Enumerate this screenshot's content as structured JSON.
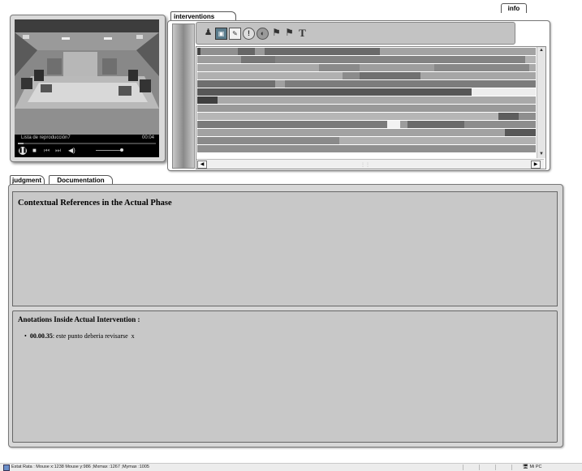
{
  "info_tab": {
    "label": "info"
  },
  "player": {
    "playlist": "Lista de reproducción7",
    "time": "00:04",
    "progress": 0.04,
    "volume": 0.9,
    "icons": [
      "pause-icon",
      "stop-icon",
      "previous-icon",
      "next-icon",
      "volume-icon"
    ]
  },
  "interventions": {
    "tab_label": "interventions",
    "toolbar_icons": [
      "user-search-icon",
      "image-icon",
      "note-icon",
      "alert-icon",
      "globe-icon",
      "flag-icon",
      "flag-icon",
      "text-icon"
    ],
    "scroll": {
      "up": "▲",
      "down": "▼",
      "left": "◀",
      "right": "▶"
    },
    "tracks": [
      {
        "segments": [
          {
            "start": 0.0,
            "end": 0.01,
            "color": "#444444"
          },
          {
            "start": 0.01,
            "end": 0.12,
            "color": "#8f8f8f"
          },
          {
            "start": 0.12,
            "end": 0.17,
            "color": "#666666"
          },
          {
            "start": 0.17,
            "end": 0.2,
            "color": "#9a9a9a"
          },
          {
            "start": 0.2,
            "end": 0.54,
            "color": "#6a6a6a"
          },
          {
            "start": 0.54,
            "end": 1.0,
            "color": "#a3a3a3"
          }
        ]
      },
      {
        "segments": [
          {
            "start": 0.0,
            "end": 0.13,
            "color": "#9d9d9d"
          },
          {
            "start": 0.13,
            "end": 0.23,
            "color": "#767676"
          },
          {
            "start": 0.23,
            "end": 0.97,
            "color": "#838383"
          },
          {
            "start": 0.97,
            "end": 1.0,
            "color": "#b4b4b4"
          }
        ]
      },
      {
        "segments": [
          {
            "start": 0.0,
            "end": 0.36,
            "color": "#a9a9a9"
          },
          {
            "start": 0.36,
            "end": 0.48,
            "color": "#8a8a8a"
          },
          {
            "start": 0.48,
            "end": 0.7,
            "color": "#9e9e9e"
          },
          {
            "start": 0.7,
            "end": 0.98,
            "color": "#888888"
          },
          {
            "start": 0.98,
            "end": 1.0,
            "color": "#aaaaaa"
          }
        ]
      },
      {
        "segments": [
          {
            "start": 0.0,
            "end": 0.43,
            "color": "#b0b0b0"
          },
          {
            "start": 0.43,
            "end": 0.48,
            "color": "#8b8b8b"
          },
          {
            "start": 0.48,
            "end": 0.66,
            "color": "#707070"
          },
          {
            "start": 0.66,
            "end": 1.0,
            "color": "#a6a6a6"
          }
        ]
      },
      {
        "segments": [
          {
            "start": 0.0,
            "end": 0.23,
            "color": "#6f6f6f"
          },
          {
            "start": 0.23,
            "end": 0.26,
            "color": "#a0a0a0"
          },
          {
            "start": 0.26,
            "end": 1.0,
            "color": "#7c7c7c"
          }
        ]
      },
      {
        "segments": [
          {
            "start": 0.0,
            "end": 0.81,
            "color": "#575757"
          },
          {
            "start": 0.81,
            "end": 1.0,
            "color": "#ededed"
          }
        ]
      },
      {
        "segments": [
          {
            "start": 0.0,
            "end": 0.06,
            "color": "#3f3f3f"
          },
          {
            "start": 0.06,
            "end": 1.0,
            "color": "#a9a9a9"
          }
        ]
      },
      {
        "segments": [
          {
            "start": 0.0,
            "end": 1.0,
            "color": "#999999"
          }
        ]
      },
      {
        "segments": [
          {
            "start": 0.0,
            "end": 0.89,
            "color": "#b6b6b6"
          },
          {
            "start": 0.89,
            "end": 0.95,
            "color": "#5e5e5e"
          },
          {
            "start": 0.95,
            "end": 1.0,
            "color": "#8e8e8e"
          }
        ]
      },
      {
        "segments": [
          {
            "start": 0.0,
            "end": 0.56,
            "color": "#7b7b7b"
          },
          {
            "start": 0.56,
            "end": 0.6,
            "color": "#f2f2f2"
          },
          {
            "start": 0.6,
            "end": 0.62,
            "color": "#9c9c9c"
          },
          {
            "start": 0.62,
            "end": 0.79,
            "color": "#6a6a6a"
          },
          {
            "start": 0.79,
            "end": 1.0,
            "color": "#8d8d8d"
          }
        ]
      },
      {
        "segments": [
          {
            "start": 0.0,
            "end": 0.91,
            "color": "#a2a2a2"
          },
          {
            "start": 0.91,
            "end": 1.0,
            "color": "#575757"
          }
        ]
      },
      {
        "segments": [
          {
            "start": 0.0,
            "end": 0.42,
            "color": "#8a8a8a"
          },
          {
            "start": 0.42,
            "end": 1.0,
            "color": "#b0b0b0"
          }
        ]
      },
      {
        "segments": [
          {
            "start": 0.0,
            "end": 1.0,
            "color": "#909090"
          }
        ]
      }
    ]
  },
  "tabs": {
    "judgment": "judgment",
    "documentation": "Documentation"
  },
  "judgment": {
    "context_title": "Contextual References in the Actual Phase",
    "annotations_title": "Anotations Inside Actual Intervention :",
    "annotation": {
      "time": "00.00.35",
      "text": ": este punto deberia revisarse",
      "delete": "x"
    }
  },
  "status": {
    "text": "Estat Rata : Mouse x:1238 Mouse y:986 ;Mxmax :1267 ;Mymax :1005",
    "zone": "Mi PC"
  }
}
